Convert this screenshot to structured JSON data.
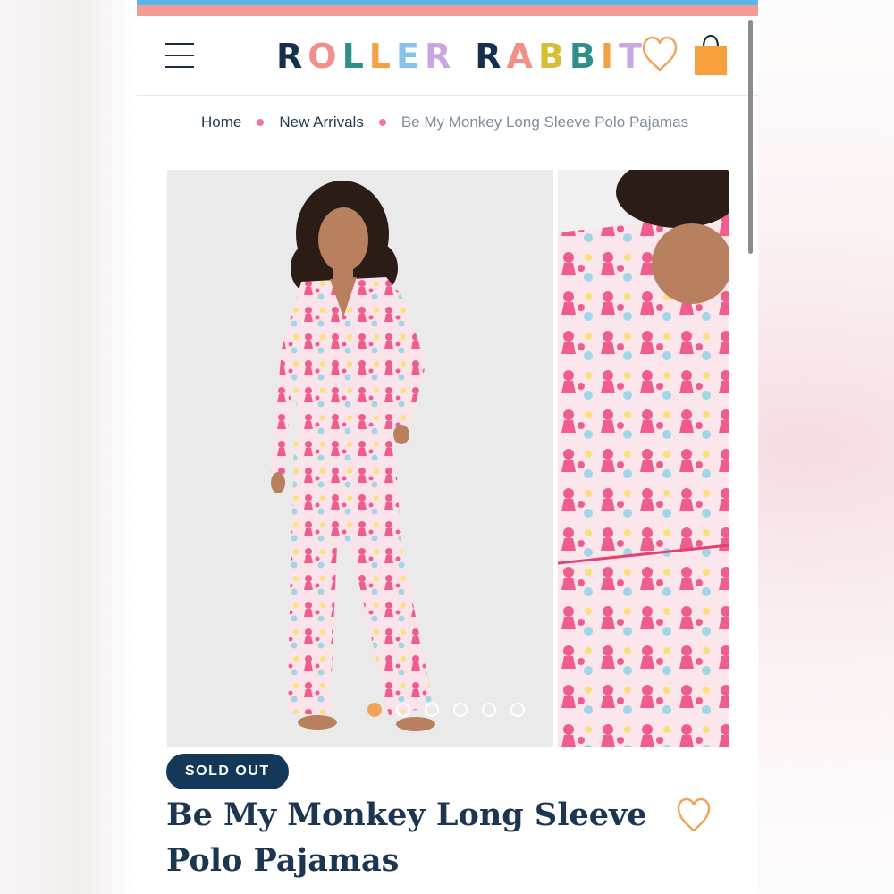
{
  "header": {
    "logo": {
      "letters": [
        {
          "char": "R",
          "color": "#15304d"
        },
        {
          "char": "O",
          "color": "#f38f89"
        },
        {
          "char": "L",
          "color": "#2f8f86"
        },
        {
          "char": "L",
          "color": "#f4a145"
        },
        {
          "char": "E",
          "color": "#85c3ea"
        },
        {
          "char": "R",
          "color": "#c8a7e0"
        },
        {
          "char": " ",
          "color": "#ffffff"
        },
        {
          "char": "R",
          "color": "#15304d"
        },
        {
          "char": "A",
          "color": "#f38f89"
        },
        {
          "char": "B",
          "color": "#d6bf36"
        },
        {
          "char": "B",
          "color": "#2f8f86"
        },
        {
          "char": "I",
          "color": "#f4a145"
        },
        {
          "char": "T",
          "color": "#c8a7e0"
        }
      ]
    },
    "icons": {
      "menu": "hamburger-menu-icon",
      "wishlist": "heart-icon",
      "cart": "shopping-bag-icon"
    },
    "accent_colors": {
      "stripe_top": "#58b6e8",
      "stripe_bottom": "#f49c93",
      "heart": "#f2a35a",
      "bag": "#f5a03c"
    }
  },
  "breadcrumb": {
    "items": [
      {
        "label": "Home"
      },
      {
        "label": "New Arrivals"
      },
      {
        "label": "Be My Monkey Long Sleeve Polo Pajamas"
      }
    ],
    "separator_color": "#ef78a0"
  },
  "gallery": {
    "image_count": 6,
    "active_index": 0
  },
  "product": {
    "badge": "SOLD OUT",
    "title_lines": [
      "Be My Monkey Long Sleeve",
      "Polo Pajamas"
    ],
    "title_color": "#1c3551",
    "badge_color": "#14385a"
  }
}
